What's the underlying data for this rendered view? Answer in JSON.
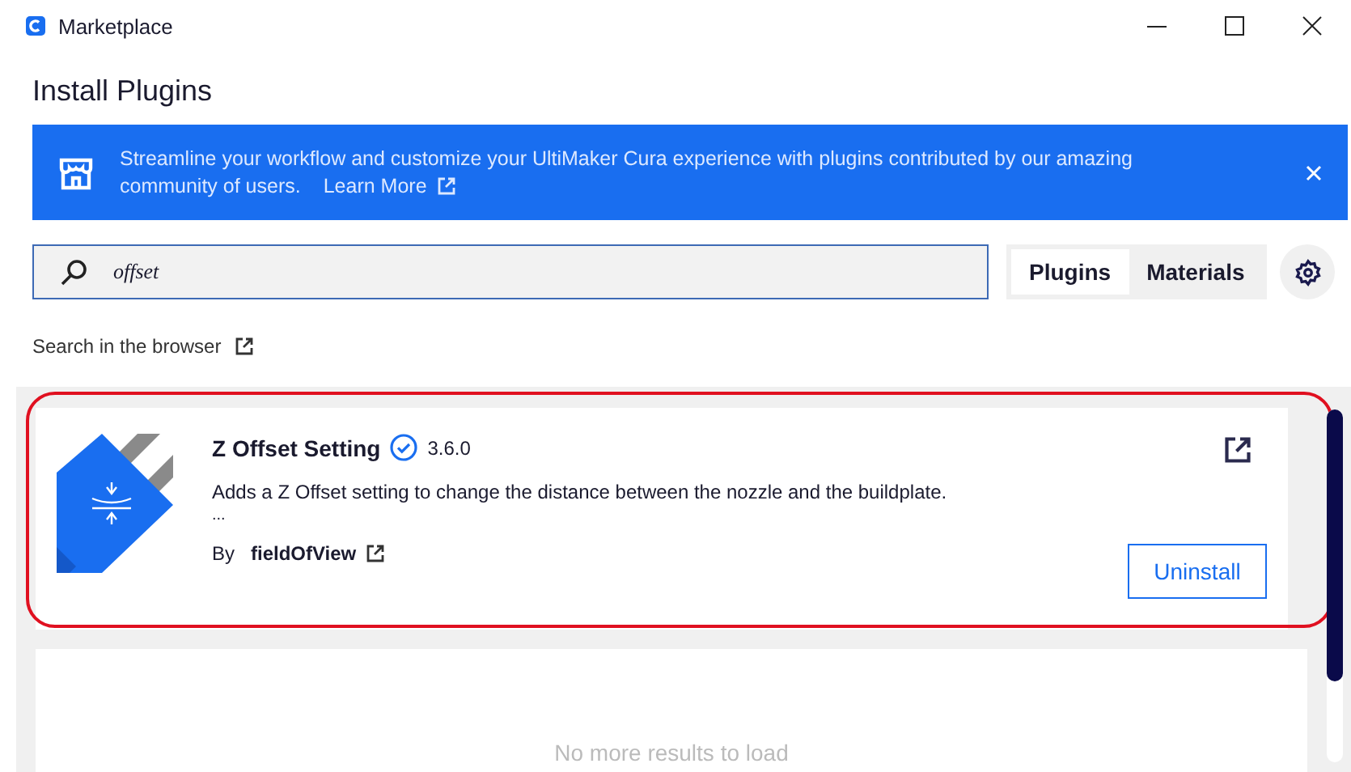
{
  "window": {
    "title": "Marketplace"
  },
  "heading": "Install Plugins",
  "banner": {
    "text": "Streamline your workflow and customize your UltiMaker Cura experience with plugins contributed by our amazing community of users.",
    "link": "Learn More"
  },
  "search": {
    "value": "offset"
  },
  "tabs": [
    {
      "label": "Plugins",
      "selected": true
    },
    {
      "label": "Materials",
      "selected": false
    }
  ],
  "browser_link": "Search in the browser",
  "plugins": [
    {
      "name": "Z Offset Setting",
      "verified": true,
      "version": "3.6.0",
      "description": "Adds a Z Offset setting to change the distance between the nozzle and the buildplate.",
      "more": "...",
      "author_prefix": "By",
      "author": "fieldOfView",
      "action": "Uninstall",
      "highlighted": true
    }
  ],
  "end_message": "No more results to load"
}
